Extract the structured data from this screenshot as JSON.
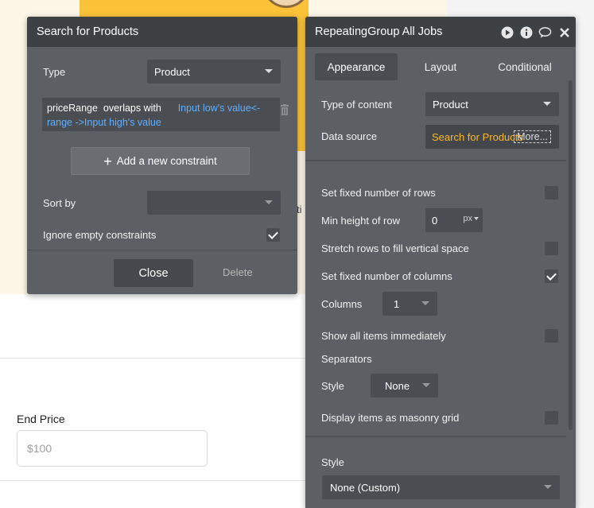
{
  "search_panel": {
    "title": "Search for Products",
    "type_label": "Type",
    "type_value": "Product",
    "constraint": {
      "field": "priceRange",
      "operator": "overlaps with",
      "value_part1": "Input low's value<-",
      "value_part2": "range ->Input high's value"
    },
    "add_constraint_label": "Add a new constraint",
    "sort_by_label": "Sort by",
    "sort_by_value": "",
    "ignore_empty_label": "Ignore empty constraints",
    "ignore_empty_checked": true,
    "close_label": "Close",
    "delete_label": "Delete"
  },
  "rg_panel": {
    "title": "RepeatingGroup All Jobs",
    "tabs": [
      {
        "label": "Appearance",
        "active": true
      },
      {
        "label": "Layout",
        "active": false
      },
      {
        "label": "Conditional",
        "active": false
      }
    ],
    "type_of_content_label": "Type of content",
    "type_of_content_value": "Product",
    "data_source_label": "Data source",
    "data_source_value": "Search for Products",
    "more_label": "More...",
    "fixed_rows_label": "Set fixed number of rows",
    "fixed_rows_checked": false,
    "min_height_label": "Min height of row",
    "min_height_value": "0",
    "min_height_unit": "px",
    "stretch_rows_label": "Stretch rows to fill vertical space",
    "stretch_rows_checked": false,
    "fixed_columns_label": "Set fixed number of columns",
    "fixed_columns_checked": true,
    "columns_label": "Columns",
    "columns_value": "1",
    "show_all_label": "Show all items immediately",
    "show_all_checked": false,
    "separators_label": "Separators",
    "sep_style_label": "Style",
    "sep_style_value": "None",
    "masonry_label": "Display items as masonry grid",
    "masonry_checked": false,
    "style_label": "Style",
    "style_value": "None (Custom)"
  },
  "canvas": {
    "peek_text": "ti",
    "end_price_label": "End Price",
    "end_price_placeholder": "$100"
  },
  "colors": {
    "panel_bg": "#5c6064",
    "panel_header": "#3e4144",
    "dropdown_bg": "#4a4d51",
    "dynamic_blue": "#5fb0ff",
    "dynamic_orange": "#fcb72b",
    "hero_orange": "#fcc338"
  }
}
